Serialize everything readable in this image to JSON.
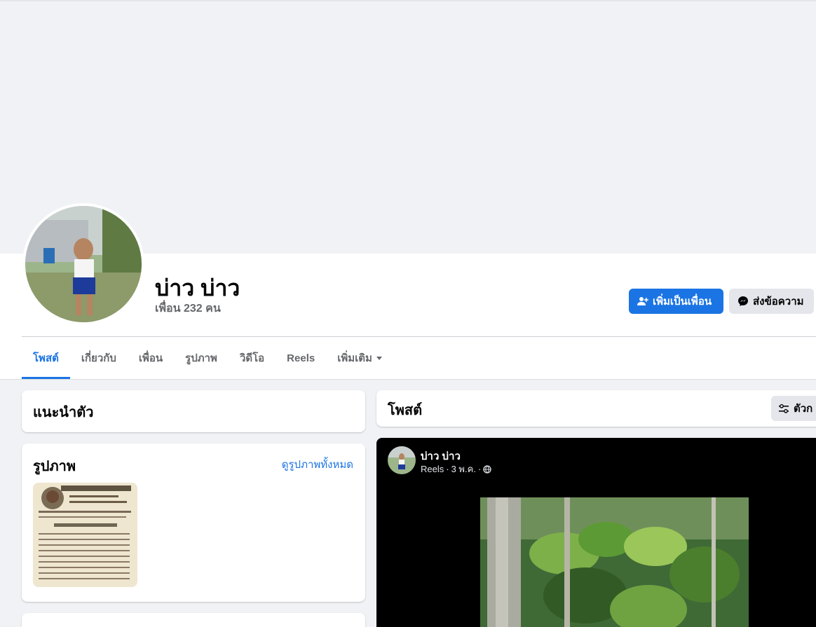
{
  "profile": {
    "name": "บ่าว บ่าว",
    "friends_count": "เพื่อน 232 คน",
    "add_friend_label": "เพิ่มเป็นเพื่อน",
    "message_label": "ส่งข้อความ"
  },
  "tabs": [
    {
      "label": "โพสต์",
      "active": true
    },
    {
      "label": "เกี่ยวกับ",
      "active": false
    },
    {
      "label": "เพื่อน",
      "active": false
    },
    {
      "label": "รูปภาพ",
      "active": false
    },
    {
      "label": "วิดีโอ",
      "active": false
    },
    {
      "label": "Reels",
      "active": false
    },
    {
      "label": "เพิ่มเติม",
      "active": false
    }
  ],
  "intro": {
    "title": "แนะนำตัว"
  },
  "photos": {
    "title": "รูปภาพ",
    "see_all": "ดูรูปภาพทั้งหมด"
  },
  "posts": {
    "title": "โพสต์",
    "filter_label": "ตัวก"
  },
  "reel_post": {
    "author": "บ่าว บ่าว",
    "source": "Reels",
    "date": "3 พ.ค.",
    "separator": "·"
  },
  "colors": {
    "primary": "#1b74e4",
    "secondary_button": "#e4e6eb",
    "background": "#f0f2f5",
    "muted_text": "#65676b"
  },
  "icons": {
    "add_friend": "person-add-icon",
    "message": "messenger-icon",
    "more": "caret-down-icon",
    "filter": "filter-sliders-icon",
    "privacy": "globe-icon"
  }
}
